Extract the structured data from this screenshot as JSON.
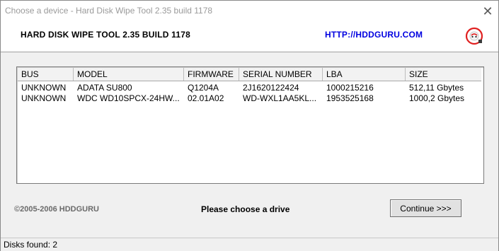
{
  "window": {
    "title": "Choose a device - Hard Disk Wipe Tool 2.35 build 1178",
    "close_glyph": "✕"
  },
  "header": {
    "app_title": "HARD DISK WIPE TOOL 2.35 BUILD 1178",
    "link": "HTTP://HDDGURU.COM",
    "logo_icon": "hddguru-logo-icon"
  },
  "table": {
    "columns": [
      "BUS",
      "MODEL",
      "FIRMWARE",
      "SERIAL NUMBER",
      "LBA",
      "SIZE"
    ],
    "rows": [
      [
        "UNKNOWN",
        "ADATA SU800",
        "Q1204A",
        "2J1620122424",
        "1000215216",
        "512,11 Gbytes"
      ],
      [
        "UNKNOWN",
        "WDC WD10SPCX-24HW...",
        "02.01A02",
        "WD-WXL1AA5KL...",
        "1953525168",
        "1000,2 Gbytes"
      ]
    ]
  },
  "footer": {
    "copyright": "©2005-2006 HDDGURU",
    "prompt": "Please choose a drive",
    "continue_label": "Continue >>>"
  },
  "status": {
    "text": "Disks found: 2"
  },
  "colors": {
    "link": "#0000e0",
    "background": "#f0f0f0",
    "logo_red": "#e02020"
  }
}
